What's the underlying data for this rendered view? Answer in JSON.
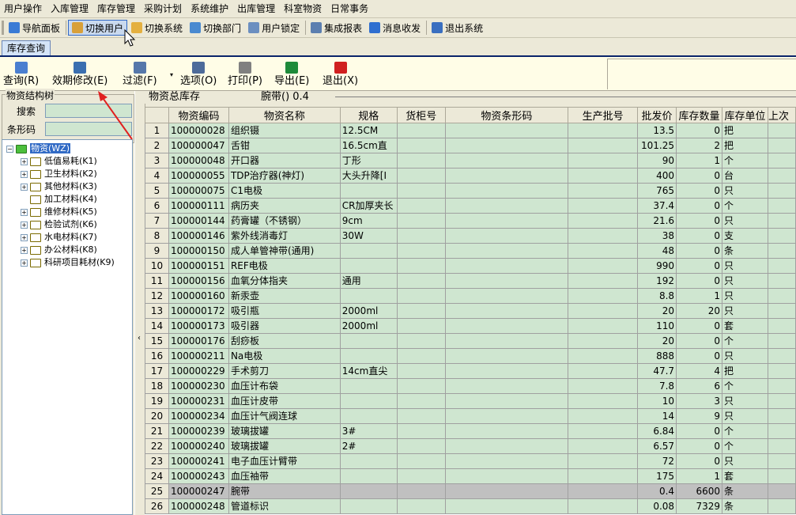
{
  "menu": [
    "用户操作",
    "入库管理",
    "库存管理",
    "采购计划",
    "系统维护",
    "出库管理",
    "科室物资",
    "日常事务"
  ],
  "toolbar": [
    {
      "label": "导航面板",
      "icon": "navigation-panel-icon",
      "color": "#3a7bd5"
    },
    {
      "label": "切换用户",
      "icon": "switch-user-icon",
      "color": "#d8a03a",
      "active": true
    },
    {
      "label": "切换系统",
      "icon": "switch-system-icon",
      "color": "#e4b040"
    },
    {
      "label": "切换部门",
      "icon": "switch-department-icon",
      "color": "#4a8ad0"
    },
    {
      "label": "用户锁定",
      "icon": "user-lock-icon",
      "color": "#6b8fc0"
    },
    {
      "label": "集成报表",
      "icon": "integrated-report-icon",
      "color": "#5c7fb0"
    },
    {
      "label": "消息收发",
      "icon": "message-icon",
      "color": "#2f6fd0"
    },
    {
      "label": "退出系统",
      "icon": "exit-system-icon",
      "color": "#3a6fc0"
    }
  ],
  "tab": "库存查询",
  "actions": [
    {
      "label": "查询(R)",
      "icon": "query-icon",
      "color": "#4a7fd0"
    },
    {
      "label": "效期修改(E)",
      "icon": "edit-expiry-icon",
      "color": "#3a6fb0"
    },
    {
      "label": "过滤(F)",
      "icon": "filter-icon",
      "color": "#5577aa"
    },
    {
      "label": "选项(O)",
      "icon": "options-icon",
      "color": "#4d6b9a"
    },
    {
      "label": "打印(P)",
      "icon": "print-icon",
      "color": "#808080"
    },
    {
      "label": "导出(E)",
      "icon": "export-excel-icon",
      "color": "#1e8a3a"
    },
    {
      "label": "退出(X)",
      "icon": "exit-icon",
      "color": "#d02020"
    }
  ],
  "left_panel": {
    "group_title": "物资结构树",
    "search_label": "搜索",
    "barcode_label": "条形码",
    "tree_root": "物资(WZ)",
    "tree_items": [
      {
        "label": "低值易耗(K1)",
        "expandable": true
      },
      {
        "label": "卫生材料(K2)",
        "expandable": true
      },
      {
        "label": "其他材料(K3)",
        "expandable": true
      },
      {
        "label": "加工材料(K4)",
        "expandable": false
      },
      {
        "label": "维修材料(K5)",
        "expandable": true
      },
      {
        "label": "检验试剂(K6)",
        "expandable": true
      },
      {
        "label": "水电材料(K7)",
        "expandable": true
      },
      {
        "label": "办公材料(K8)",
        "expandable": true
      },
      {
        "label": "科研项目耗材(K9)",
        "expandable": true
      }
    ]
  },
  "grid_title": "物资总库存",
  "grid_subtitle": "腕带() 0.4",
  "columns": [
    "物资编码",
    "物资名称",
    "规格",
    "货柜号",
    "物资条形码",
    "生产批号",
    "批发价",
    "库存数量",
    "库存单位",
    "上次"
  ],
  "rows": [
    [
      "1",
      "100000028",
      "组织镊",
      "12.5CM",
      "",
      "",
      "",
      "13.5",
      "0",
      "把"
    ],
    [
      "2",
      "100000047",
      "舌钳",
      "16.5cm直",
      "",
      "",
      "",
      "101.25",
      "2",
      "把"
    ],
    [
      "3",
      "100000048",
      "开口器",
      "丁形",
      "",
      "",
      "",
      "90",
      "1",
      "个"
    ],
    [
      "4",
      "100000055",
      "TDP治疗器(神灯)",
      "大头升降[I",
      "",
      "",
      "",
      "400",
      "0",
      "台"
    ],
    [
      "5",
      "100000075",
      "C1电极",
      "",
      "",
      "",
      "",
      "765",
      "0",
      "只"
    ],
    [
      "6",
      "100000111",
      "病历夹",
      "CR加厚夹长",
      "",
      "",
      "",
      "37.4",
      "0",
      "个"
    ],
    [
      "7",
      "100000144",
      "药膏罐（不锈钢）",
      "9cm",
      "",
      "",
      "",
      "21.6",
      "0",
      "只"
    ],
    [
      "8",
      "100000146",
      "紫外线消毒灯",
      "30W",
      "",
      "",
      "",
      "38",
      "0",
      "支"
    ],
    [
      "9",
      "100000150",
      "成人单管神带(通用)",
      "",
      "",
      "",
      "",
      "48",
      "0",
      "条"
    ],
    [
      "10",
      "100000151",
      "REF电极",
      "",
      "",
      "",
      "",
      "990",
      "0",
      "只"
    ],
    [
      "11",
      "100000156",
      "血氧分体指夹",
      "通用",
      "",
      "",
      "",
      "192",
      "0",
      "只"
    ],
    [
      "12",
      "100000160",
      "新汞壶",
      "",
      "",
      "",
      "",
      "8.8",
      "1",
      "只"
    ],
    [
      "13",
      "100000172",
      "吸引瓶",
      "2000ml",
      "",
      "",
      "",
      "20",
      "20",
      "只"
    ],
    [
      "14",
      "100000173",
      "吸引器",
      "2000ml",
      "",
      "",
      "",
      "110",
      "0",
      "套"
    ],
    [
      "15",
      "100000176",
      "刮痧板",
      "",
      "",
      "",
      "",
      "20",
      "0",
      "个"
    ],
    [
      "16",
      "100000211",
      "Na电极",
      "",
      "",
      "",
      "",
      "888",
      "0",
      "只"
    ],
    [
      "17",
      "100000229",
      "手术剪刀",
      "14cm直尖",
      "",
      "",
      "",
      "47.7",
      "4",
      "把"
    ],
    [
      "18",
      "100000230",
      "血压计布袋",
      "",
      "",
      "",
      "",
      "7.8",
      "6",
      "个"
    ],
    [
      "19",
      "100000231",
      "血压计皮带",
      "",
      "",
      "",
      "",
      "10",
      "3",
      "只"
    ],
    [
      "20",
      "100000234",
      "血压计气阀连球",
      "",
      "",
      "",
      "",
      "14",
      "9",
      "只"
    ],
    [
      "21",
      "100000239",
      "玻璃拔罐",
      "3#",
      "",
      "",
      "",
      "6.84",
      "0",
      "个"
    ],
    [
      "22",
      "100000240",
      "玻璃拔罐",
      "2#",
      "",
      "",
      "",
      "6.57",
      "0",
      "个"
    ],
    [
      "23",
      "100000241",
      "电子血压计臂带",
      "",
      "",
      "",
      "",
      "72",
      "0",
      "只"
    ],
    [
      "24",
      "100000243",
      "血压袖带",
      "",
      "",
      "",
      "",
      "175",
      "1",
      "套"
    ],
    [
      "25",
      "100000247",
      "腕带",
      "",
      "",
      "",
      "",
      "0.4",
      "6600",
      "条"
    ],
    [
      "26",
      "100000248",
      "管道标识",
      "",
      "",
      "",
      "",
      "0.08",
      "7329",
      "条"
    ]
  ],
  "selected_row": 25
}
